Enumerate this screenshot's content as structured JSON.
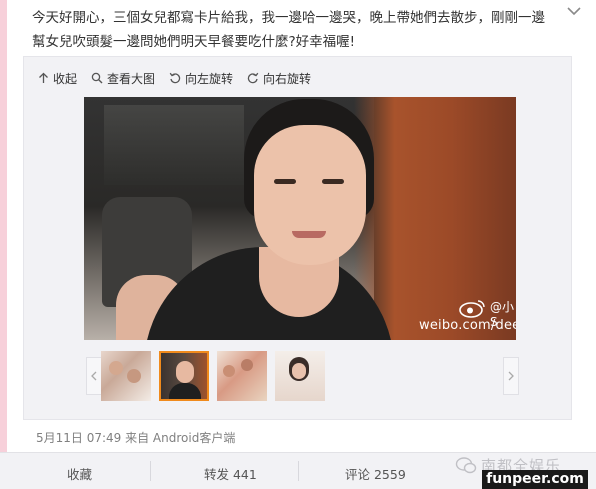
{
  "post": {
    "text": "今天好開心，三個女兒都寫卡片給我，我一邊哈一邊哭，晚上帶她們去散步，剛剛一邊幫女兒吹頭髮一邊問她們明天早餐要吃什麼?好幸福喔!"
  },
  "toolbar": {
    "collapse_label": "收起",
    "view_large_label": "查看大图",
    "rotate_left_label": "向左旋转",
    "rotate_right_label": "向右旋转"
  },
  "photo": {
    "watermark_name": "@小S",
    "watermark_url": "weibo.com/dees"
  },
  "thumbnails": {
    "active_index": 1,
    "count": 4
  },
  "meta": {
    "text": "5月11日 07:49 来自 Android客户端"
  },
  "actions": {
    "favorite_label": "收藏",
    "repost_label": "转发 441",
    "comment_label": "评论 2559"
  },
  "branding": {
    "cn_text": "南都全娱乐",
    "site_text": "funpeer.com"
  },
  "colors": {
    "accent": "#f08a1c",
    "side_strip": "#f7d0da",
    "bar_bg": "#f2f2f5"
  },
  "icons": [
    "chevron-down-icon",
    "collapse-arrow-icon",
    "magnifier-icon",
    "rotate-left-icon",
    "rotate-right-icon",
    "weibo-eye-icon",
    "chat-bubble-icon"
  ]
}
